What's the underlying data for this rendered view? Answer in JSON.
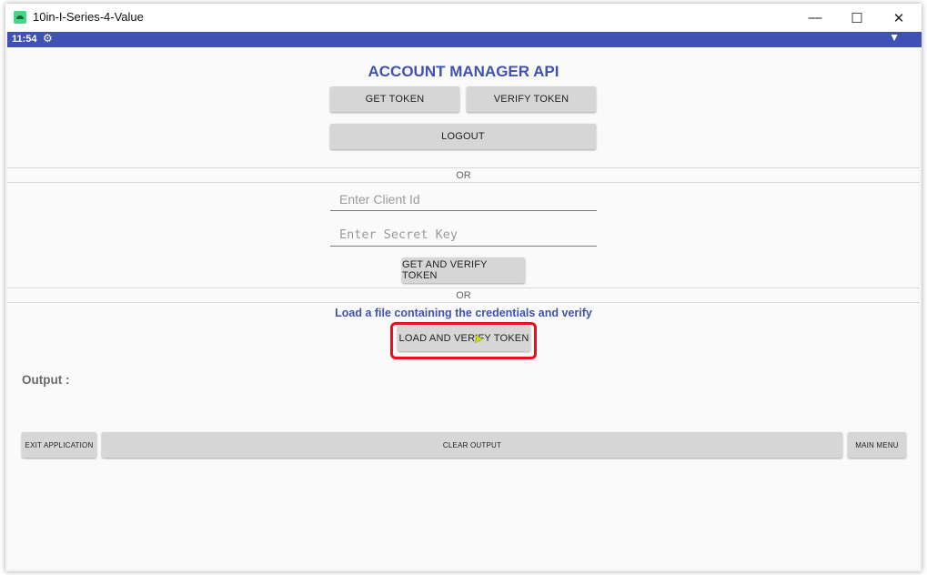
{
  "window": {
    "title": "10in-I-Series-4-Value",
    "controls": {
      "minimize": "—",
      "maximize": "☐",
      "close": "✕"
    }
  },
  "status_bar": {
    "time": "11:54",
    "icons": [
      "gear-icon",
      "wifi-icon"
    ],
    "color": "#3f51b5"
  },
  "app": {
    "heading": "ACCOUNT MANAGER API",
    "buttons": {
      "get_token": "GET TOKEN",
      "verify_token": "VERIFY TOKEN",
      "logout": "LOGOUT",
      "get_and_verify": "GET AND VERIFY TOKEN",
      "load_and_verify": "LOAD AND VERIFY TOKEN",
      "exit_application": "EXIT APPLICATION",
      "clear_output": "CLEAR OUTPUT",
      "main_menu": "MAIN MENU"
    },
    "separator_1": "OR",
    "separator_2": "OR",
    "client_id": {
      "placeholder": "Enter Client Id",
      "value": ""
    },
    "secret_key": {
      "placeholder": "Enter Secret Key",
      "value": ""
    },
    "load_caption": "Load a file containing the credentials and verify",
    "output_label": "Output :",
    "highlight_color": "#e8101a"
  }
}
